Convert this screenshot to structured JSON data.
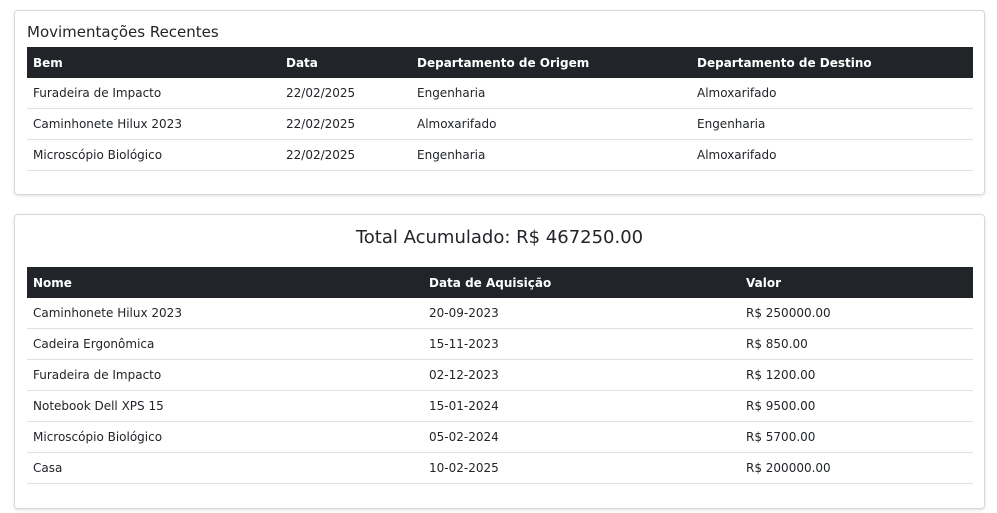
{
  "movements": {
    "title": "Movimentações Recentes",
    "columns": [
      "Bem",
      "Data",
      "Departamento de Origem",
      "Departamento de Destino"
    ],
    "rows": [
      [
        "Furadeira de Impacto",
        "22/02/2025",
        "Engenharia",
        "Almoxarifado"
      ],
      [
        "Caminhonete Hilux 2023",
        "22/02/2025",
        "Almoxarifado",
        "Engenharia"
      ],
      [
        "Microscópio Biológico",
        "22/02/2025",
        "Engenharia",
        "Almoxarifado"
      ]
    ]
  },
  "assets": {
    "total_label": "Total Acumulado: R$ 467250.00",
    "columns": [
      "Nome",
      "Data de Aquisição",
      "Valor"
    ],
    "rows": [
      [
        "Caminhonete Hilux 2023",
        "20-09-2023",
        "R$ 250000.00"
      ],
      [
        "Cadeira Ergonômica",
        "15-11-2023",
        "R$ 850.00"
      ],
      [
        "Furadeira de Impacto",
        "02-12-2023",
        "R$ 1200.00"
      ],
      [
        "Notebook Dell XPS 15",
        "15-01-2024",
        "R$ 9500.00"
      ],
      [
        "Microscópio Biológico",
        "05-02-2024",
        "R$ 5700.00"
      ],
      [
        "Casa",
        "10-02-2025",
        "R$ 200000.00"
      ]
    ]
  },
  "colors": {
    "table_header_bg": "#212529",
    "table_header_text": "#ffffff",
    "row_border": "#dee2e6"
  }
}
